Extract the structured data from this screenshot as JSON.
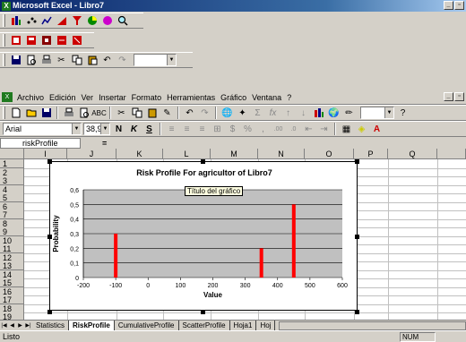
{
  "window": {
    "title": "Microsoft Excel - Libro7",
    "min": "_",
    "max": "▫",
    "close": "×",
    "app_icon": "X"
  },
  "toolbars": {
    "row1_icons": [
      "chart-wizard-icon",
      "scatter-icon",
      "line-chart-icon",
      "bar-chart-icon",
      "pie-icon",
      "zoom-icon"
    ],
    "row2_icons": [
      "sheet-icon",
      "sheet-icon-2",
      "sheet-icon-3",
      "sheet-icon-4",
      "sheet-icon-5"
    ],
    "row3_icons": [
      "save-icon",
      "print-preview-icon",
      "print-icon",
      "cut-icon",
      "copy-icon",
      "paste-icon",
      "undo-icon",
      "redo-icon"
    ]
  },
  "menu": {
    "items": [
      "Archivo",
      "Edición",
      "Ver",
      "Insertar",
      "Formato",
      "Herramientas",
      "Gráfico",
      "Ventana",
      "?"
    ],
    "doc_icon": "X"
  },
  "format": {
    "font_name": "Arial",
    "font_size": "38,9",
    "bold": "N",
    "italic": "K",
    "underline": "S"
  },
  "formula": {
    "name_box": "riskProfile",
    "equals": "="
  },
  "columns": [
    "I",
    "J",
    "K",
    "L",
    "M",
    "N",
    "O",
    "P",
    "Q"
  ],
  "rows": [
    "1",
    "2",
    "3",
    "4",
    "5",
    "6",
    "7",
    "8",
    "9",
    "10",
    "11",
    "12",
    "13",
    "14",
    "15",
    "16",
    "17",
    "18",
    "19"
  ],
  "chart_data": {
    "type": "bar",
    "title": "Risk Profile For agricultor of Libro7",
    "xlabel": "Value",
    "ylabel": "Probability",
    "xlim": [
      -200,
      600
    ],
    "ylim": [
      0,
      0.6
    ],
    "xticks": [
      "-200",
      "-100",
      "0",
      "100",
      "200",
      "300",
      "400",
      "500",
      "600"
    ],
    "yticks": [
      "0",
      "0,1",
      "0,2",
      "0,3",
      "0,4",
      "0,5",
      "0,6"
    ],
    "x": [
      -100,
      350,
      450
    ],
    "values": [
      0.3,
      0.2,
      0.5
    ],
    "bar_color": "#ff0000",
    "plot_bg": "#c0c0c0",
    "grid": true,
    "tooltip": "Título del gráfico"
  },
  "sheets": [
    "Statistics",
    "RiskProfile",
    "CumulativeProfile",
    "ScatterProfile",
    "Hoja1",
    "Hoj"
  ],
  "active_sheet": "RiskProfile",
  "status": {
    "text": "Listo",
    "num": "NUM"
  }
}
